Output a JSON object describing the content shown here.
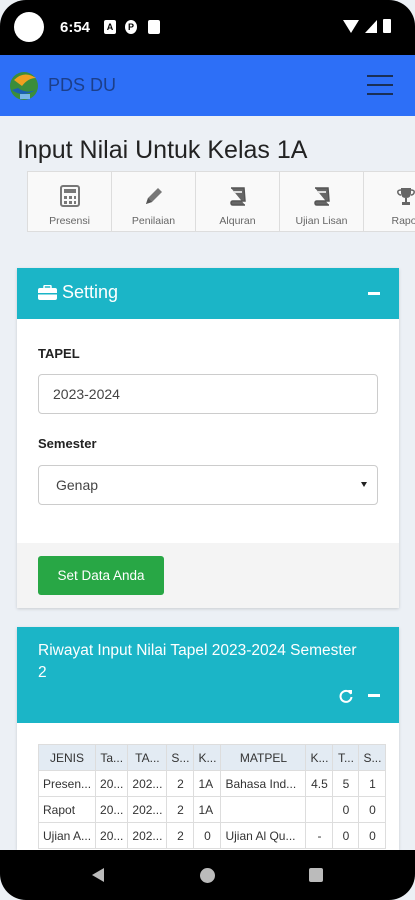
{
  "status_bar": {
    "time": "6:54"
  },
  "navbar": {
    "brand": "PDS DU"
  },
  "page_title": "Input Nilai Untuk Kelas 1A",
  "tabs": [
    {
      "label": "Presensi",
      "icon": "calculator-icon"
    },
    {
      "label": "Penilaian",
      "icon": "pencil-icon"
    },
    {
      "label": "Alquran",
      "icon": "book-icon"
    },
    {
      "label": "Ujian Lisan",
      "icon": "book-icon"
    },
    {
      "label": "Rapot",
      "icon": "trophy-icon"
    }
  ],
  "setting": {
    "title": "Setting",
    "tapel_label": "TAPEL",
    "tapel_value": "2023-2024",
    "semester_label": "Semester",
    "semester_value": "Genap",
    "submit_label": "Set Data Anda"
  },
  "riwayat": {
    "title": "Riwayat Input Nilai Tapel 2023-2024 Semester 2",
    "columns": [
      "JENIS",
      "Ta...",
      "TA...",
      "S...",
      "K...",
      "MATPEL",
      "K...",
      "T...",
      "S..."
    ],
    "rows": [
      [
        "Presen...",
        "20...",
        "202...",
        "2",
        "1A",
        "Bahasa Ind...",
        "4.5",
        "5",
        "1"
      ],
      [
        "Rapot",
        "20...",
        "202...",
        "2",
        "1A",
        "",
        "",
        "0",
        "0"
      ],
      [
        "Ujian A...",
        "20...",
        "202...",
        "2",
        "0",
        "Ujian Al Qu...",
        "-",
        "0",
        "0"
      ]
    ]
  },
  "colors": {
    "navbar": "#2d6ff7",
    "card_header": "#1bb5c7",
    "submit_button": "#28a745"
  }
}
